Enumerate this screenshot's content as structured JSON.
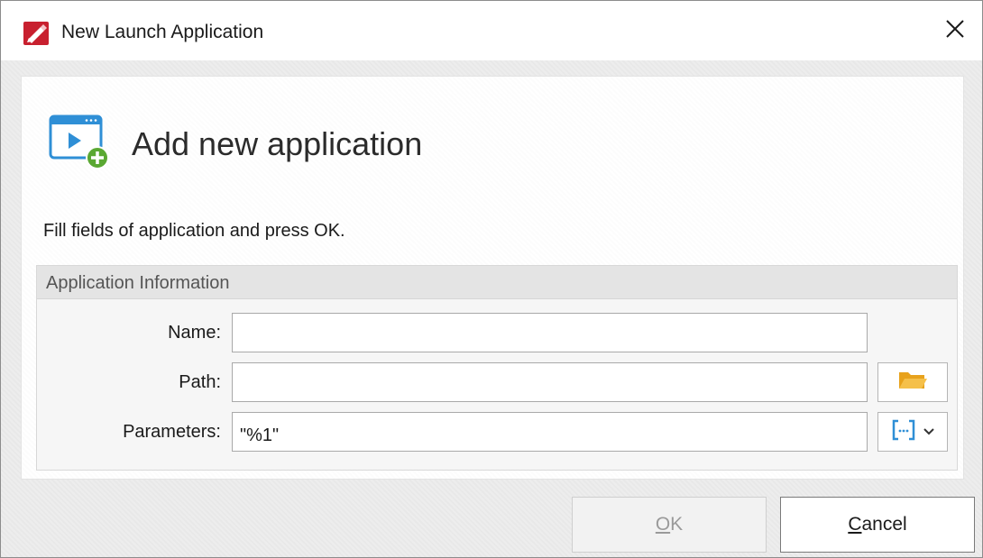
{
  "window": {
    "title": "New Launch Application",
    "close_icon": "close-icon",
    "app_icon": "pdf-editor-app-icon"
  },
  "header": {
    "title": "Add new application",
    "icon": "add-application-icon"
  },
  "instructions": "Fill fields of application and press OK.",
  "group": {
    "title": "Application Information",
    "fields": {
      "name": {
        "label": "Name:",
        "value": ""
      },
      "path": {
        "label": "Path:",
        "value": ""
      },
      "parameters": {
        "label": "Parameters:",
        "value": "\"%1\""
      }
    },
    "browse_icon": "folder-icon",
    "macro_icon": "macro-brackets-icon",
    "dropdown_icon": "chevron-down-icon"
  },
  "buttons": {
    "ok": {
      "accel": "O",
      "rest": "K"
    },
    "cancel": {
      "accel": "C",
      "rest": "ancel"
    }
  },
  "colors": {
    "app_icon_red": "#c8202f",
    "accent_blue": "#2f8fd6",
    "plus_green": "#5aa832",
    "folder_yellow": "#f2b534"
  }
}
